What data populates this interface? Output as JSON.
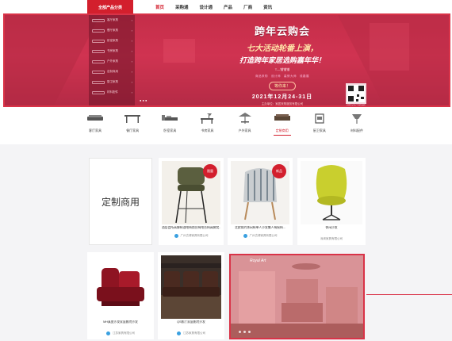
{
  "topnav": {
    "all_categories": "全部产品分类",
    "links": [
      "首页",
      "采购通",
      "设计通",
      "产品",
      "厂商",
      "资讯"
    ]
  },
  "banner": {
    "title": "跨年云购会",
    "subtitle1": "七大活动轮番上演，",
    "subtitle2": "打造跨年家居选购嘉年华！",
    "tag": "T—铺铺铺",
    "links": "商品采购　设计师　装修大师　线路展",
    "cta": "等你来！",
    "date": "2021年12月24-31日",
    "organizer": "主办单位：家居采购服务有限公司",
    "qr_label": "扫码关注了解详情",
    "side_categories": [
      "客厅家具",
      "餐厅家具",
      "卧室家具",
      "书房家具",
      "户外家具",
      "定制商用",
      "厨卫家具",
      "材料配件"
    ]
  },
  "categories": [
    {
      "label": "客厅家具",
      "icon": "sofa-icon",
      "active": false
    },
    {
      "label": "餐厅家具",
      "icon": "dining-table-icon",
      "active": false
    },
    {
      "label": "卧室家具",
      "icon": "bed-icon",
      "active": false
    },
    {
      "label": "书房家具",
      "icon": "desk-lamp-icon",
      "active": false
    },
    {
      "label": "户外家具",
      "icon": "parasol-icon",
      "active": false
    },
    {
      "label": "定制商用",
      "icon": "commercial-icon",
      "active": true
    },
    {
      "label": "厨卫家具",
      "icon": "kitchen-icon",
      "active": false
    },
    {
      "label": "材料配件",
      "icon": "material-icon",
      "active": false
    }
  ],
  "feature_card": {
    "label": "定制商用"
  },
  "products": [
    {
      "title": "酒店会所高脚椅酒吧椅前台椅吧台椅高脚凳...",
      "store": "广州古博家具有限公司",
      "badge": "限量",
      "image": "bar-stool-image"
    },
    {
      "title": "北欧简约休闲椅单人沙发懒人椅摇椅...",
      "store": "广州古博家具有限公司",
      "badge": "新品",
      "image": "striped-lounge-chair-image"
    },
    {
      "title": "休闲沙发",
      "store": "深圳家具有限公司",
      "badge": "",
      "image": "yellow-egg-chair-image"
    },
    {
      "title": "MH真皮沙发家庭影院沙发",
      "store": "江苏家具有限公司",
      "badge": "",
      "image": "red-cinema-sofa-image"
    },
    {
      "title": "QS影厅家庭影院沙发",
      "store": "江苏家具有限公司",
      "badge": "",
      "image": "theater-seating-image"
    }
  ],
  "highlight_banner": {
    "logo": "Royal Art",
    "image": "living-room-showcase-image"
  },
  "colors": {
    "accent": "#d31f2d",
    "banner": "#c8294a",
    "highlight": "#d93348"
  }
}
